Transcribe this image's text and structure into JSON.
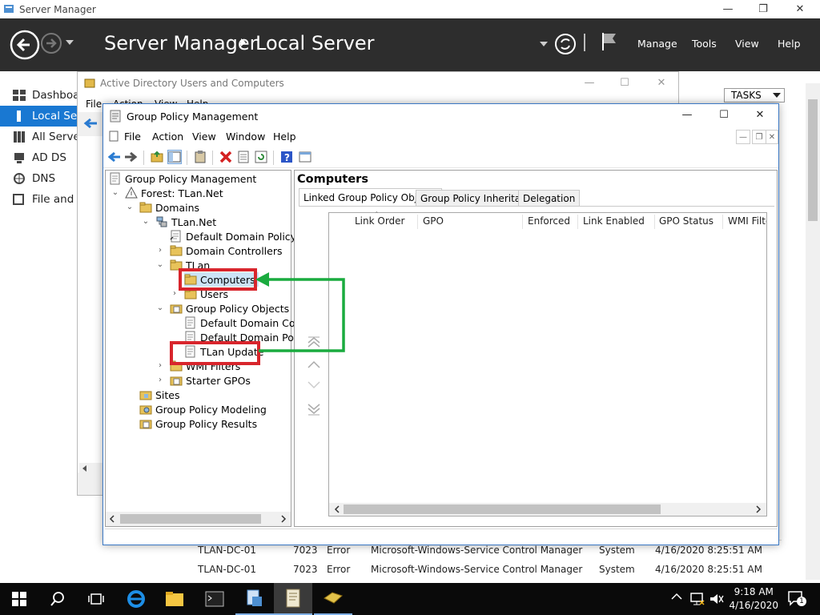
{
  "server_manager": {
    "window_title": "Server Manager",
    "breadcrumb_root": "Server Manager",
    "breadcrumb_page": "Local Server",
    "menus": [
      "Manage",
      "Tools",
      "View",
      "Help"
    ],
    "nav_items": [
      "Dashboard",
      "Local Server",
      "All Servers",
      "AD DS",
      "DNS",
      "File and Storage Services"
    ],
    "tasks_label": "TASKS",
    "events": [
      {
        "server": "TLAN-DC-01",
        "id": "7023",
        "severity": "Error",
        "source": "Microsoft-Windows-Service Control Manager",
        "log": "System",
        "date": "4/16/2020 8:25:51 AM"
      },
      {
        "server": "TLAN-DC-01",
        "id": "7023",
        "severity": "Error",
        "source": "Microsoft-Windows-Service Control Manager",
        "log": "System",
        "date": "4/16/2020 8:25:51 AM"
      }
    ]
  },
  "aduc": {
    "title": "Active Directory Users and Computers",
    "menu": [
      "File",
      "Action",
      "View",
      "Help"
    ]
  },
  "gpm": {
    "title": "Group Policy Management",
    "menu": [
      "File",
      "Action",
      "View",
      "Window",
      "Help"
    ],
    "tree": {
      "root": "Group Policy Management",
      "forest": "Forest: TLan.Net",
      "domains": "Domains",
      "domain": "TLan.Net",
      "default_domain_policy": "Default Domain Policy",
      "domain_controllers": "Domain Controllers",
      "ou": "TLan",
      "computers": "Computers",
      "users": "Users",
      "gpo_container": "Group Policy Objects",
      "gpo_1": "Default Domain Cont",
      "gpo_2": "Default Domain Polic",
      "gpo_3": "TLan Update",
      "wmi_filters": "WMI Filters",
      "starter_gpos": "Starter GPOs",
      "sites": "Sites",
      "modeling": "Group Policy Modeling",
      "results": "Group Policy Results"
    },
    "pane_title": "Computers",
    "tabs": [
      "Linked Group Policy Objects",
      "Group Policy Inheritance",
      "Delegation"
    ],
    "columns": [
      "Link Order",
      "GPO",
      "Enforced",
      "Link Enabled",
      "GPO Status",
      "WMI Filter"
    ]
  },
  "taskbar": {
    "time": "9:18 AM",
    "date": "4/16/2020",
    "notification_count": "1"
  },
  "colors": {
    "highlight_box": "#d8252c",
    "arrow": "#1aab3f",
    "selected_nav": "#1978d2",
    "header_bg": "#2d2d2d"
  }
}
